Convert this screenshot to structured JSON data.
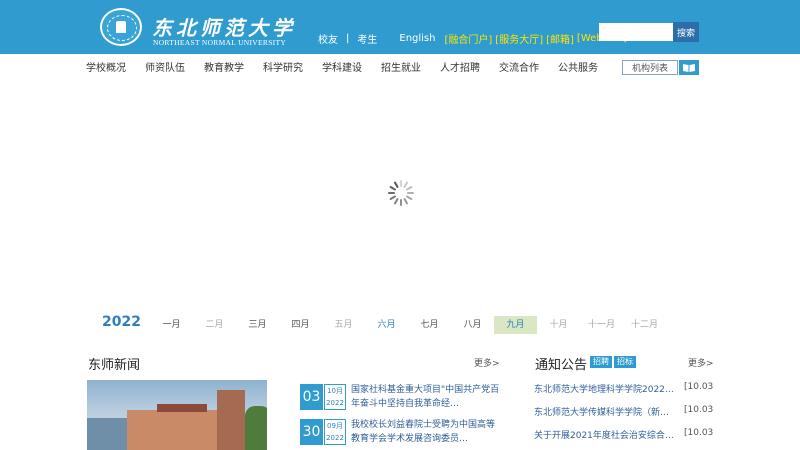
{
  "header": {
    "logo_cn": "东北师范大学",
    "logo_en": "NORTHEAST NORMAL UNIVERSITY",
    "links": {
      "alumni": "校友",
      "separator": "|",
      "examinee": "考生",
      "english": "English",
      "portal": "[融合门户]",
      "service_hall": "[服务大厅]",
      "mail": "[邮箱]",
      "webvpn": "[WebVPN]"
    },
    "search_placeholder": "",
    "search_button": "搜索"
  },
  "nav": {
    "items": [
      "学校概况",
      "师资队伍",
      "教育教学",
      "科学研究",
      "学科建设",
      "招生就业",
      "人才招聘",
      "交流合作",
      "公共服务"
    ],
    "org_list": "机构列表"
  },
  "timeline": {
    "year": "2022",
    "months": [
      {
        "label": "一月",
        "state": "normal"
      },
      {
        "label": "二月",
        "state": "dim"
      },
      {
        "label": "三月",
        "state": "normal"
      },
      {
        "label": "四月",
        "state": "normal"
      },
      {
        "label": "五月",
        "state": "dim"
      },
      {
        "label": "六月",
        "state": "blue"
      },
      {
        "label": "七月",
        "state": "normal"
      },
      {
        "label": "八月",
        "state": "normal"
      },
      {
        "label": "九月",
        "state": "active"
      },
      {
        "label": "十月",
        "state": "dim"
      },
      {
        "label": "十一月",
        "state": "dim"
      },
      {
        "label": "十二月",
        "state": "dim"
      }
    ]
  },
  "news": {
    "title": "东师新闻",
    "more": "更多>",
    "items": [
      {
        "day": "03",
        "month": "10月",
        "year": "2022",
        "text": "国家社科基金重大项目\"中国共产党百年奋斗中坚持自我革命经…"
      },
      {
        "day": "30",
        "month": "09月",
        "year": "2022",
        "text": "我校校长刘益春院士受聘为中国高等教育学会学术发展咨询委员…"
      }
    ]
  },
  "notice": {
    "title": "通知公告",
    "tags": [
      "招聘",
      "招标"
    ],
    "more": "更多>",
    "items": [
      {
        "text": "东北师范大学地理科学学院2022…",
        "date": "[10.03"
      },
      {
        "text": "东北师范大学传媒科学学院（新…",
        "date": "[10.03"
      },
      {
        "text": "关于开展2021年度社会治安综合…",
        "date": "[10.03"
      }
    ]
  },
  "colors": {
    "header_bg": "#2f9bcf",
    "link_yellow": "#ffe600",
    "accent_blue": "#2f7fbf",
    "active_month_bg": "#d9e7c2"
  }
}
